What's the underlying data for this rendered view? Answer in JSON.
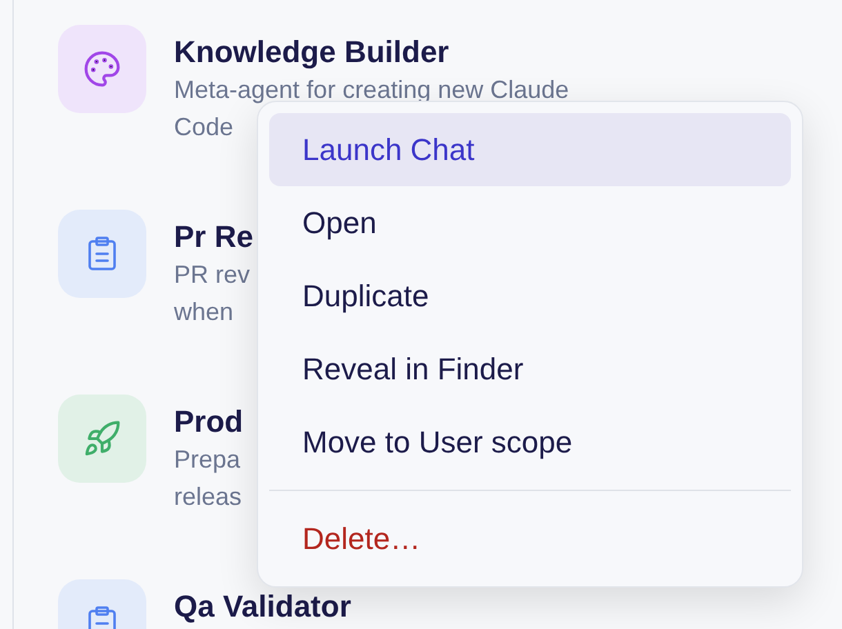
{
  "agents": [
    {
      "kind": "palette",
      "title": "Knowledge Builder",
      "description": [
        "Meta-agent for creating new Claude",
        "Code"
      ]
    },
    {
      "kind": "clipboard",
      "title": "Pr Re",
      "description": [
        "PR rev",
        "when"
      ]
    },
    {
      "kind": "rocket",
      "title": "Prod",
      "description": [
        "Prepa",
        "releas"
      ]
    },
    {
      "kind": "clipboard",
      "title": "Qa Validator"
    }
  ],
  "context_menu": {
    "items": [
      {
        "kind": "action",
        "label": "Launch Chat",
        "selected": true
      },
      {
        "kind": "action",
        "label": "Open",
        "selected": false
      },
      {
        "kind": "action",
        "label": "Duplicate",
        "selected": false
      },
      {
        "kind": "action",
        "label": "Reveal in Finder",
        "selected": false
      },
      {
        "kind": "action",
        "label": "Move to User scope",
        "selected": false
      },
      {
        "kind": "separator"
      },
      {
        "kind": "danger",
        "label": "Delete…",
        "selected": false
      }
    ]
  }
}
